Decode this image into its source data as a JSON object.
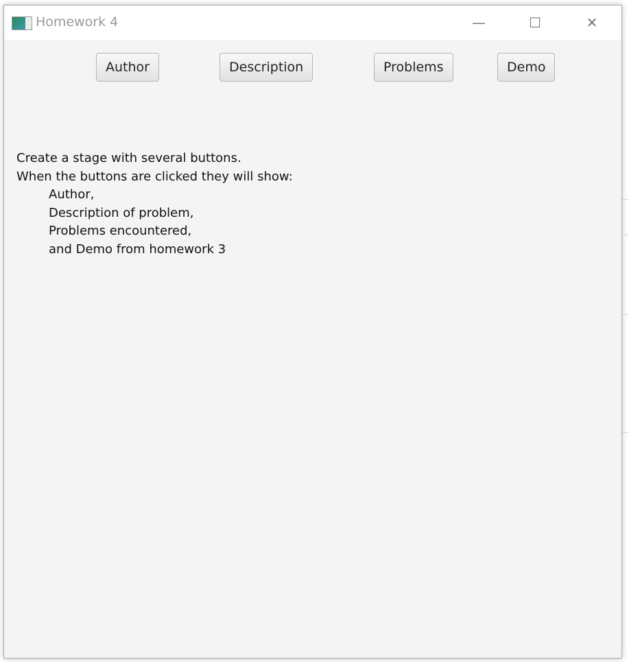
{
  "window": {
    "title": "Homework 4",
    "icon": "app-icon",
    "controls": {
      "minimize": "—",
      "maximize": "☐",
      "close": "✕"
    }
  },
  "buttons": [
    {
      "label": "Author"
    },
    {
      "label": "Description"
    },
    {
      "label": "Problems"
    },
    {
      "label": "Demo"
    }
  ],
  "content": {
    "lines": [
      "Create a stage with several buttons.",
      "When the buttons are clicked they will show:"
    ],
    "items": [
      "Author,",
      "Description of problem,",
      "Problems encountered,",
      "and Demo from homework 3"
    ]
  }
}
